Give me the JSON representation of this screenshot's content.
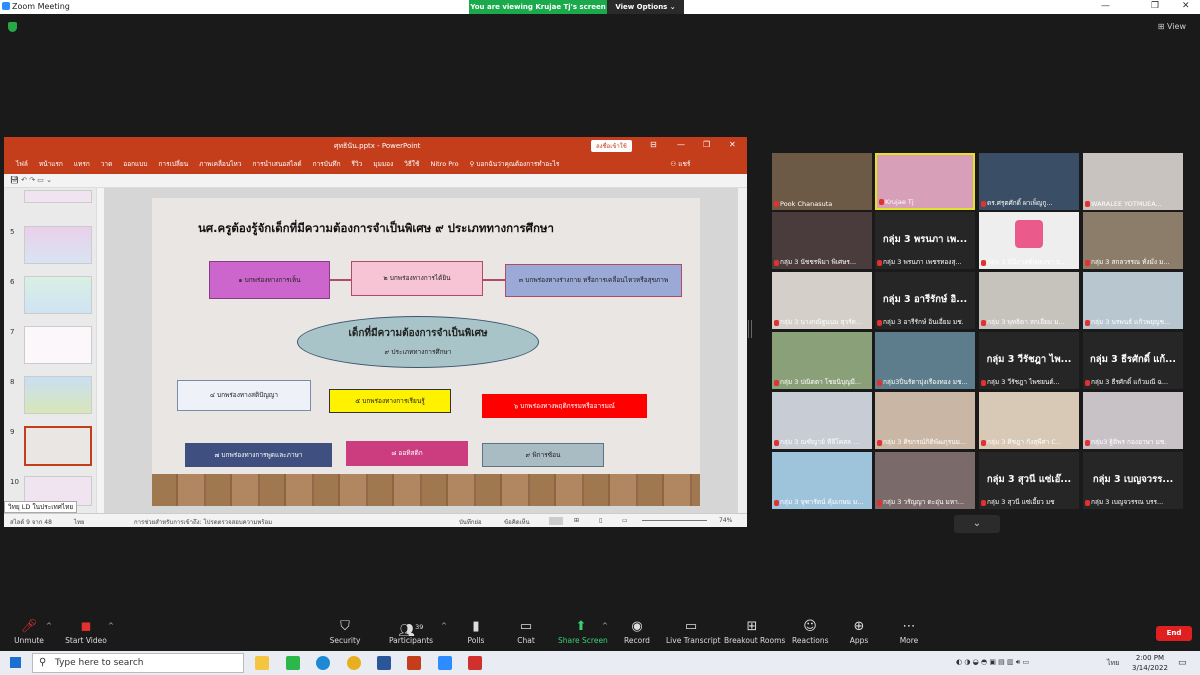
{
  "window": {
    "title": "Zoom Meeting",
    "banner": "You are viewing Krujae Tj's screen",
    "view_options": "View Options",
    "view": "View"
  },
  "ppt": {
    "filename": "ศุทธินัน.pptx - PowerPoint",
    "signin": "ลงชื่อเข้าใช้",
    "menu": [
      "ไฟล์",
      "หน้าแรก",
      "แทรก",
      "วาด",
      "ออกแบบ",
      "การเปลี่ยน",
      "ภาพเคลื่อนไหว",
      "การนำเสนอสไลด์",
      "การบันทึก",
      "รีวิว",
      "มุมมอง",
      "วิธีใช้",
      "Nitro Pro",
      "บอกฉันว่าคุณต้องการทำอะไร",
      "แชร์"
    ],
    "thumb_numbers": [
      "5",
      "6",
      "7",
      "8",
      "9",
      "10"
    ],
    "tooltip": "วิทยุ LD ในประเทศไทย",
    "status": {
      "slide": "สไลด์ 9 จาก 48",
      "lang": "ไทย",
      "access": "การช่วยสำหรับการเข้าถึง: โปรดตรวจสอบความพร้อม",
      "notes": "บันทึกย่อ",
      "comments": "ข้อคิดเห็น",
      "zoom": "74%"
    }
  },
  "slide": {
    "title": "นศ.ครูต้องรู้จักเด็กที่มีความต้องการจำเป็นพิเศษ ๙ ประเภททางการศึกษา",
    "center_main": "เด็กที่มีความต้องการจำเป็นพิเศษ",
    "center_sub": "๙ ประเภททางการศึกษา",
    "boxes": [
      "๑ บกพร่องทางการเห็น",
      "๒ บกพร่องทางการได้ยิน",
      "๓ บกพร่องทางร่างกาย หรือการเคลื่อนไหวหรือสุขภาพ",
      "๔ บกพร่องทางสติปัญญา",
      "๕ บกพร่องทางการเรียนรู้",
      "๖ บกพร่องทางพฤติกรรมหรืออารมณ์",
      "๗ บกพร่องทางการพูดและภาษา",
      "๘ ออทิสติก",
      "๙ พิการซ้อน"
    ]
  },
  "participants": [
    {
      "name": "Pook Chanasuta",
      "big": ""
    },
    {
      "name": "Krujae Tj",
      "big": ""
    },
    {
      "name": "ดร.ศรุตศักดิ์ ผาเพ็ญกู...",
      "big": ""
    },
    {
      "name": "WARALEE YOTMUEA...",
      "big": ""
    },
    {
      "name": "กลุ่ม 3 นัชชรพิมา พิเศษร...",
      "big": ""
    },
    {
      "name": "กลุ่ม 3 พรนภา เพชรทองสุ...",
      "big": "กลุ่ม 3 พรนภา เพ..."
    },
    {
      "name": "กลุ่ม 3 นันิภาสต์เพลงชา ม...",
      "big": ""
    },
    {
      "name": "กลุ่ม 3 สกลวรรณ ทั่งมั่ง ม...",
      "big": ""
    },
    {
      "name": "กลุ่ม 3 นางกณิฐนนม สุวรัต...",
      "big": ""
    },
    {
      "name": "กลุ่ม 3 อารีรักษ์ อินเอี่ยม มช.",
      "big": "กลุ่ม 3 อารีรักษ์ อิ..."
    },
    {
      "name": "กลุ่ม 3 พุทธิดา สกเอี่ยม ม...",
      "big": ""
    },
    {
      "name": "กลุ่ม 3 นรพนธ์ แก้วพยุญช...",
      "big": ""
    },
    {
      "name": "กลุ่ม 3 ปณิตตา โชยนิบุญมี...",
      "big": ""
    },
    {
      "name": "กลุ่ม3ปิ่นรัตาบุ่งเรืองทอง มช...",
      "big": ""
    },
    {
      "name": "กลุ่ม 3 วีรัชฎา ไพชยนต์...",
      "big": "กลุ่ม 3 วีรัชฎา ไพ..."
    },
    {
      "name": "กลุ่ม 3 ธีรศักดิ์ แก้วมณี ฉ...",
      "big": "กลุ่ม 3 ธีรศักดิ์ แก้..."
    },
    {
      "name": "กลุ่ม 3 ณฑิญาย์ ทีลีโคสล ...",
      "big": ""
    },
    {
      "name": "กลุ่ม 3 ศิขกรณ์กิติพัฒกุรนม...",
      "big": ""
    },
    {
      "name": "กลุ่ม 3 ศิชฎา กังสุพีศา C...",
      "big": ""
    },
    {
      "name": "กลุ่ม3 ฐิติพร กองอาษา มช.",
      "big": ""
    },
    {
      "name": "กลุ่ม 3 จุฑารัตน์ คุ้มเกษม ม...",
      "big": ""
    },
    {
      "name": "กลุ่ม 3 วรัญญา ตะอุ่น มหา...",
      "big": ""
    },
    {
      "name": "กลุ่ม 3 สุวนี แซ่เอี้ยว มช",
      "big": "กลุ่ม 3 สุวนี แซ่เอ๊..."
    },
    {
      "name": "กลุ่ม 3 เบญจวรรณ บรร...",
      "big": "กลุ่ม 3 เบญจวรร..."
    }
  ],
  "toolbar": {
    "unmute": "Unmute",
    "start_video": "Start Video",
    "security": "Security",
    "participants": "Participants",
    "participants_count": "39",
    "polls": "Polls",
    "chat": "Chat",
    "share_screen": "Share Screen",
    "record": "Record",
    "live_transcript": "Live Transcript",
    "breakout_rooms": "Breakout Rooms",
    "reactions": "Reactions",
    "apps": "Apps",
    "more": "More",
    "end": "End"
  },
  "taskbar": {
    "search_placeholder": "Type here to search",
    "time": "2:00 PM",
    "date": "3/14/2022",
    "lang": "ไทย"
  },
  "colors": {
    "ppt": "#c43e1c",
    "banner": "#1aa94b",
    "end": "#e02020",
    "share": "#3bd16f"
  }
}
